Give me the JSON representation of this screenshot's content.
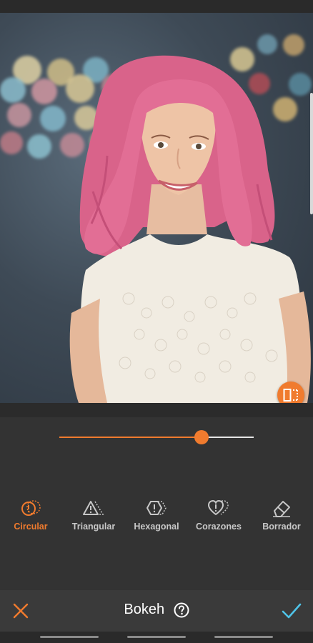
{
  "editor": {
    "title": "Bokeh",
    "accent_color": "#f07b2e",
    "confirm_color": "#4fc3e8"
  },
  "slider": {
    "value_fraction": 0.73
  },
  "tools": [
    {
      "label": "Circular",
      "icon": "circular-bokeh-icon",
      "active": true
    },
    {
      "label": "Triangular",
      "icon": "triangular-bokeh-icon",
      "active": false
    },
    {
      "label": "Hexagonal",
      "icon": "hexagonal-bokeh-icon",
      "active": false
    },
    {
      "label": "Corazones",
      "icon": "hearts-bokeh-icon",
      "active": false
    },
    {
      "label": "Borrador",
      "icon": "eraser-icon",
      "active": false
    }
  ],
  "icons": {
    "cancel": "close-icon",
    "confirm": "checkmark-icon",
    "help": "help-icon",
    "compare": "compare-icon"
  }
}
